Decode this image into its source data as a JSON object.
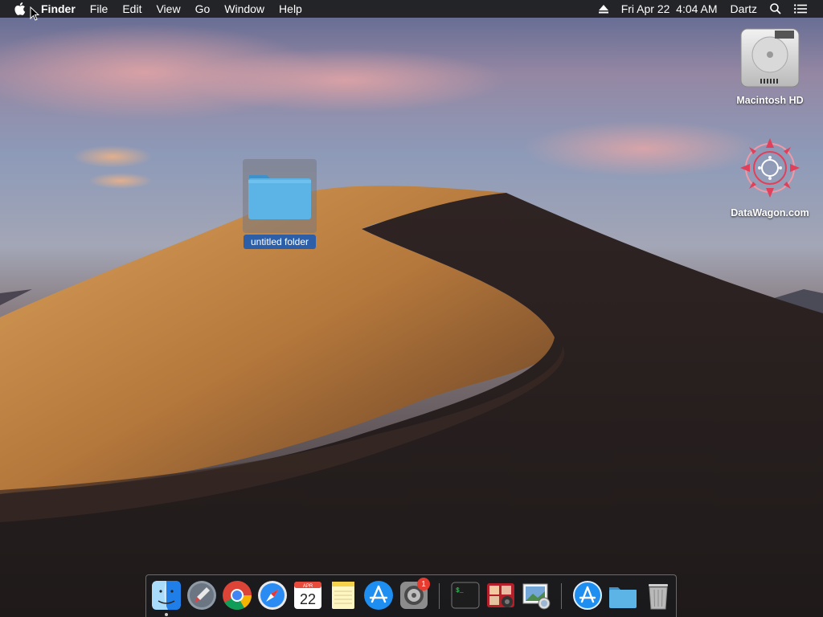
{
  "menubar": {
    "app_name": "Finder",
    "menus": [
      "File",
      "Edit",
      "View",
      "Go",
      "Window",
      "Help"
    ],
    "datetime": "Fri Apr 22  4:04 AM",
    "user": "Dartz"
  },
  "desktop": {
    "icons": [
      {
        "label": "Macintosh HD",
        "icon": "hard-drive-icon"
      },
      {
        "label": "DataWagon.com",
        "icon": "network-volume-icon"
      },
      {
        "label": "untitled folder",
        "icon": "folder-icon",
        "selected": true
      }
    ]
  },
  "dock": {
    "apps": [
      {
        "name": "Finder",
        "icon": "finder-icon",
        "running": true
      },
      {
        "name": "Launchpad",
        "icon": "launchpad-icon"
      },
      {
        "name": "Chrome",
        "icon": "chrome-icon"
      },
      {
        "name": "Safari",
        "icon": "safari-icon"
      },
      {
        "name": "Calendar",
        "icon": "calendar-icon",
        "month": "APR",
        "day": "22"
      },
      {
        "name": "Notes",
        "icon": "notes-icon"
      },
      {
        "name": "App Store",
        "icon": "app-store-icon"
      },
      {
        "name": "System Preferences",
        "icon": "system-preferences-icon",
        "badge": "1"
      },
      {
        "name": "Terminal",
        "icon": "terminal-icon",
        "text": "$_"
      },
      {
        "name": "Photo Booth",
        "icon": "photo-booth-icon"
      },
      {
        "name": "Preview",
        "icon": "preview-icon"
      },
      {
        "name": "Downloads",
        "icon": "app-store-download-icon"
      },
      {
        "name": "Documents",
        "icon": "folder-stack-icon"
      },
      {
        "name": "Trash",
        "icon": "trash-icon"
      }
    ]
  },
  "colors": {
    "menubar_bg": "#1e1e20",
    "selection_blue": "#2c5fa8",
    "folder_blue": "#5fb6e6",
    "badge_red": "#e63b2e"
  }
}
